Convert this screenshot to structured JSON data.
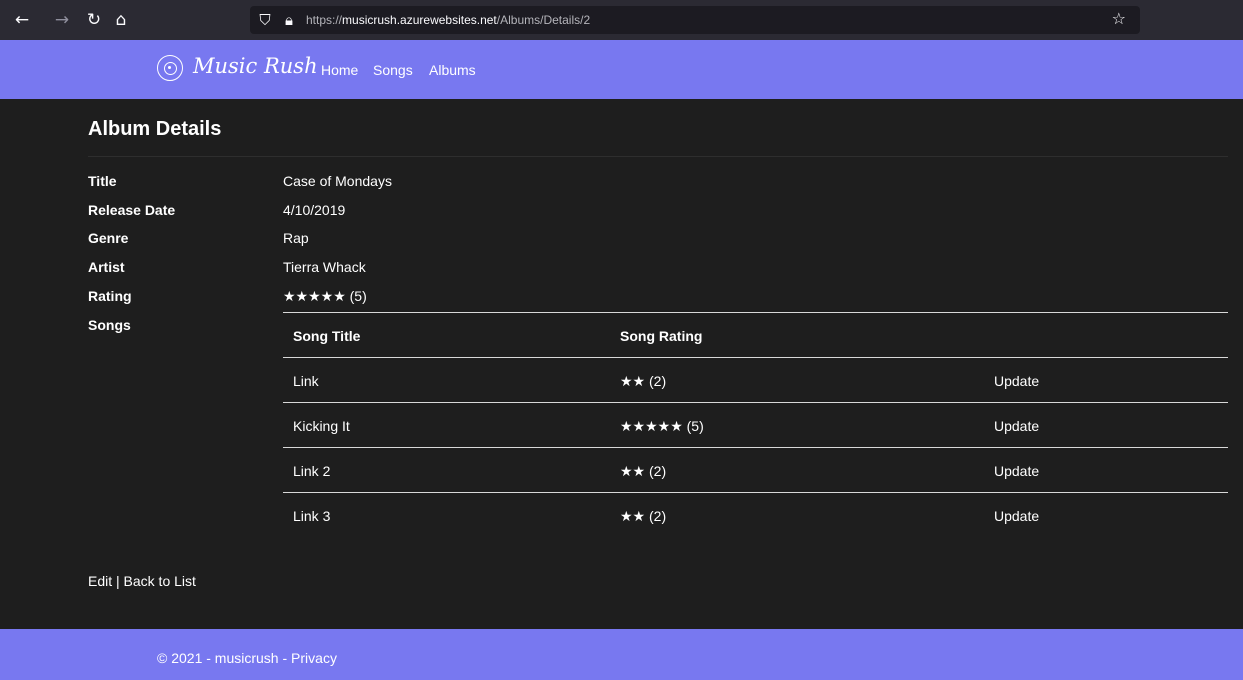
{
  "browser": {
    "url_prefix": "https://",
    "url_domain": "musicrush.azurewebsites.net",
    "url_path": "/Albums/Details/2"
  },
  "header": {
    "brand": "Music Rush",
    "nav": [
      "Home",
      "Songs",
      "Albums"
    ]
  },
  "main": {
    "title": "Album Details",
    "details": [
      {
        "label": "Title",
        "value": "Case of Mondays"
      },
      {
        "label": "Release Date",
        "value": "4/10/2019"
      },
      {
        "label": "Genre",
        "value": "Rap"
      },
      {
        "label": "Artist",
        "value": "Tierra Whack"
      },
      {
        "label": "Rating",
        "value": "★★★★★ (5)"
      },
      {
        "label": "Songs",
        "value": ""
      }
    ],
    "songs_table": {
      "headers": [
        "Song Title",
        "Song Rating",
        ""
      ],
      "rows": [
        {
          "title": "Link",
          "rating": "★★ (2)",
          "action": "Update"
        },
        {
          "title": "Kicking It",
          "rating": "★★★★★ (5)",
          "action": "Update"
        },
        {
          "title": "Link 2",
          "rating": "★★ (2)",
          "action": "Update"
        },
        {
          "title": "Link 3",
          "rating": "★★ (2)",
          "action": "Update"
        }
      ]
    },
    "links": {
      "edit": "Edit",
      "separator": "|",
      "back": "Back to List"
    }
  },
  "footer": {
    "copyright": "© 2021 - musicrush",
    "separator": "-",
    "privacy": "Privacy"
  },
  "colors": {
    "accent": "#7878f0",
    "background": "#1e1e1e",
    "chrome": "#2b2a33"
  }
}
